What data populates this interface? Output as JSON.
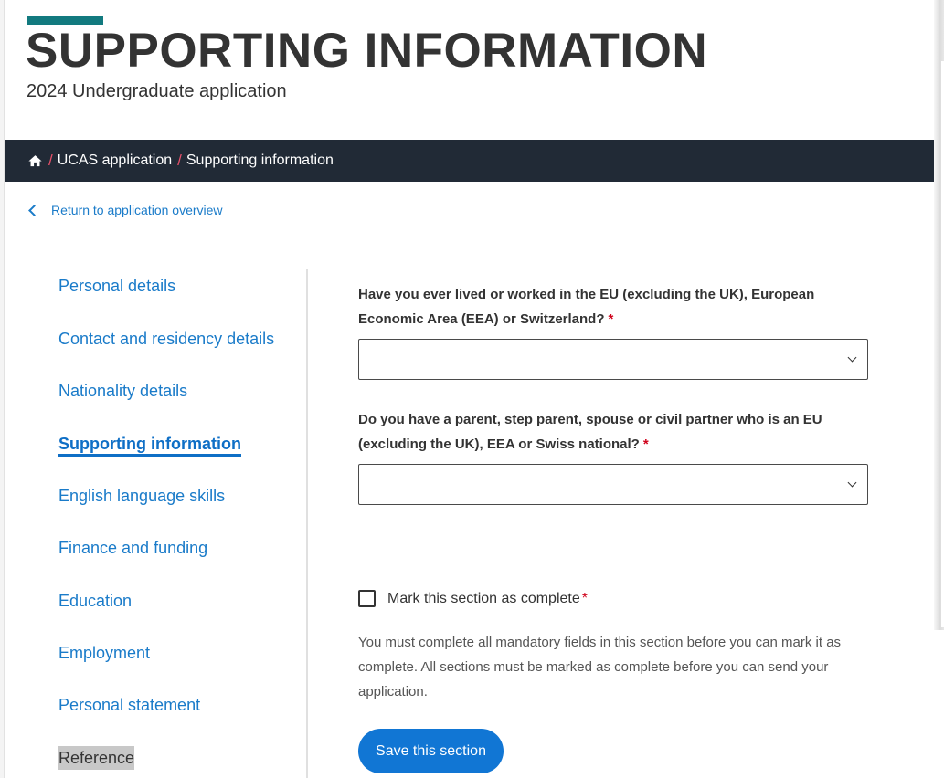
{
  "colors": {
    "accent": "#127a7f",
    "breadcrumb_bg": "#212a36",
    "breadcrumb_separator": "#e8506a",
    "link": "#1a7bc9",
    "active_link": "#0f6fc6",
    "button_bg": "#1176d4",
    "required": "#d0021b"
  },
  "header": {
    "title": "SUPPORTING INFORMATION",
    "subtitle": "2024 Undergraduate application"
  },
  "breadcrumb": {
    "home_icon": "home-icon",
    "separator": "/",
    "items": [
      "UCAS application",
      "Supporting information"
    ]
  },
  "back_link": {
    "icon": "chevron-left-icon",
    "label": "Return to application overview"
  },
  "sidenav": {
    "items": [
      {
        "label": "Personal details",
        "state": "default"
      },
      {
        "label": "Contact and residency details",
        "state": "default"
      },
      {
        "label": "Nationality details",
        "state": "default"
      },
      {
        "label": "Supporting information",
        "state": "active"
      },
      {
        "label": "English language skills",
        "state": "default"
      },
      {
        "label": "Finance and funding",
        "state": "default"
      },
      {
        "label": "Education",
        "state": "default"
      },
      {
        "label": "Employment",
        "state": "default"
      },
      {
        "label": "Personal statement",
        "state": "default"
      },
      {
        "label": "Reference",
        "state": "highlighted"
      }
    ]
  },
  "form": {
    "questions": [
      {
        "label": "Have you ever lived or worked in the EU (excluding the UK), European Economic Area (EEA) or Switzerland?",
        "required_marker": "*",
        "selected_value": ""
      },
      {
        "label": "Do you have a parent, step parent, spouse or civil partner who is an EU (excluding the UK), EEA or Swiss national?",
        "required_marker": "*",
        "selected_value": ""
      }
    ],
    "complete_checkbox": {
      "label": "Mark this section as complete",
      "required_marker": "*",
      "checked": false
    },
    "help_text": "You must complete all mandatory fields in this section before you can mark it as complete. All sections must be marked as complete before you can send your application.",
    "save_button": "Save this section"
  }
}
